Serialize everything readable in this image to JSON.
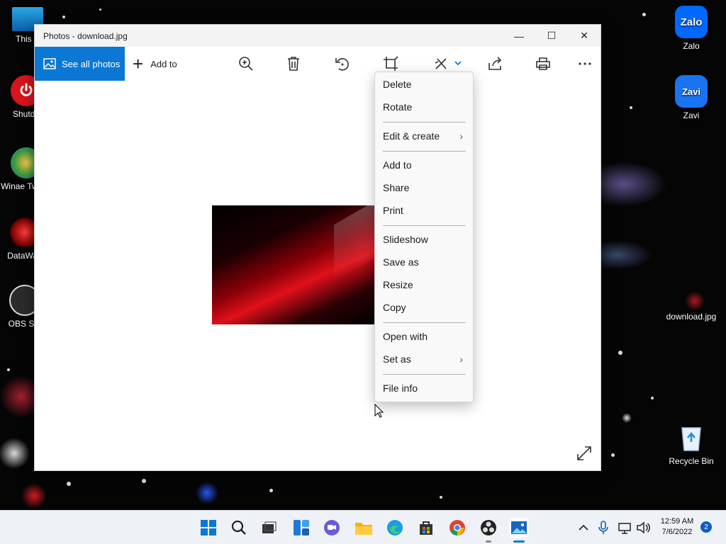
{
  "window": {
    "title": "Photos - download.jpg",
    "minimize_glyph": "—",
    "maximize_glyph": "☐",
    "close_glyph": "✕"
  },
  "toolbar": {
    "see_all_photos": "See all photos",
    "add_to": "Add to",
    "plus_glyph": "+",
    "icons": [
      "zoom-icon",
      "delete-icon",
      "rotate-icon",
      "crop-icon",
      "edit-create-icon",
      "share-icon",
      "print-icon",
      "more-icon"
    ]
  },
  "context_menu": {
    "items": [
      {
        "label": "Delete"
      },
      {
        "label": "Rotate"
      },
      {
        "label": "Edit & create",
        "submenu": true
      },
      {
        "label": "Add to"
      },
      {
        "label": "Share"
      },
      {
        "label": "Print"
      },
      {
        "label": "Slideshow"
      },
      {
        "label": "Save as"
      },
      {
        "label": "Resize"
      },
      {
        "label": "Copy"
      },
      {
        "label": "Open with"
      },
      {
        "label": "Set as",
        "submenu": true
      },
      {
        "label": "File info"
      }
    ],
    "chevron_glyph": "›"
  },
  "desktop": {
    "icons": [
      {
        "label": "This P"
      },
      {
        "label": "Shutdo"
      },
      {
        "label": "Winae Tweak"
      },
      {
        "label": "DataWag"
      },
      {
        "label": "OBS Stu"
      },
      {
        "label": "Zalo"
      },
      {
        "label": "Zavi"
      },
      {
        "label": "download.jpg"
      },
      {
        "label": "Recycle Bin"
      }
    ],
    "zalo_logo": "Zalo",
    "zavi_logo": "Zavi"
  },
  "taskbar": {
    "time": "12:59 AM",
    "date": "7/6/2022",
    "notification_count": "2",
    "apps": [
      "start-icon",
      "search-icon",
      "task-view-icon",
      "widgets-icon",
      "chat-icon",
      "file-explorer-icon",
      "edge-icon",
      "store-icon",
      "chrome-icon",
      "obs-icon",
      "photos-icon"
    ]
  },
  "colors": {
    "accent": "#0a78d4",
    "menu_bg": "#f9f9f9",
    "taskbar_bg": "#eef1f6"
  }
}
